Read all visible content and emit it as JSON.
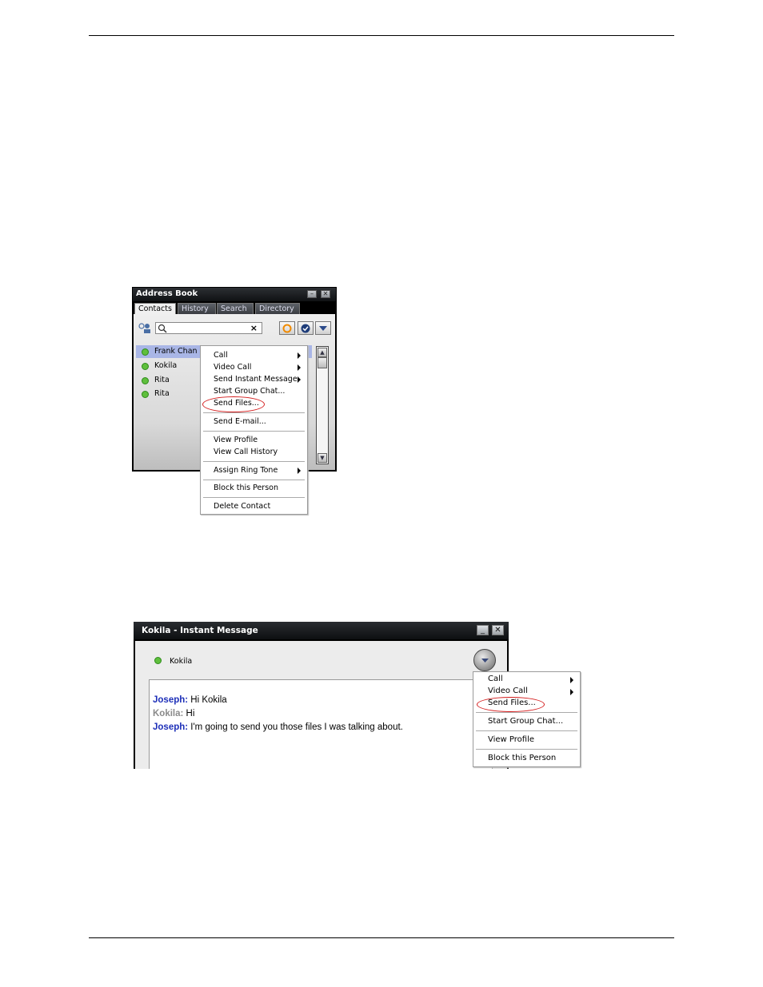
{
  "address_book": {
    "title": "Address Book",
    "tabs": [
      "Contacts",
      "History",
      "Search",
      "Directory"
    ],
    "active_tab": "Contacts",
    "contacts": [
      {
        "name": "Frank Chan",
        "selected": true
      },
      {
        "name": "Kokila",
        "selected": false
      },
      {
        "name": "Rita",
        "selected": false
      },
      {
        "name": "Rita",
        "selected": false
      }
    ],
    "context_menu": {
      "items": [
        "Call",
        "Video Call",
        "Send Instant Message",
        "Start Group Chat...",
        "Send Files...",
        "Send E-mail...",
        "View Profile",
        "View Call History",
        "Assign Ring Tone",
        "Block this Person",
        "Delete Contact"
      ],
      "highlighted": "Send Files..."
    }
  },
  "im_window": {
    "title": "Kokila - Instant Message",
    "contact_name": "Kokila",
    "messages": [
      {
        "speaker": "Joseph:",
        "text": " Hi Kokila"
      },
      {
        "speaker": "Kokila:",
        "text": " Hi"
      },
      {
        "speaker": "Joseph:",
        "text": " I'm going to send you those files I was talking about."
      }
    ],
    "context_menu": {
      "items": [
        "Call",
        "Video Call",
        "Send Files...",
        "Start Group Chat...",
        "View Profile",
        "Block this Person"
      ],
      "highlighted": "Send Files..."
    }
  },
  "colors": {
    "status_online": "#5fbf3d",
    "selection": "#a9b6e6",
    "highlight_circle": "#d41c1c",
    "speaker_joseph": "#1d2fb8"
  }
}
